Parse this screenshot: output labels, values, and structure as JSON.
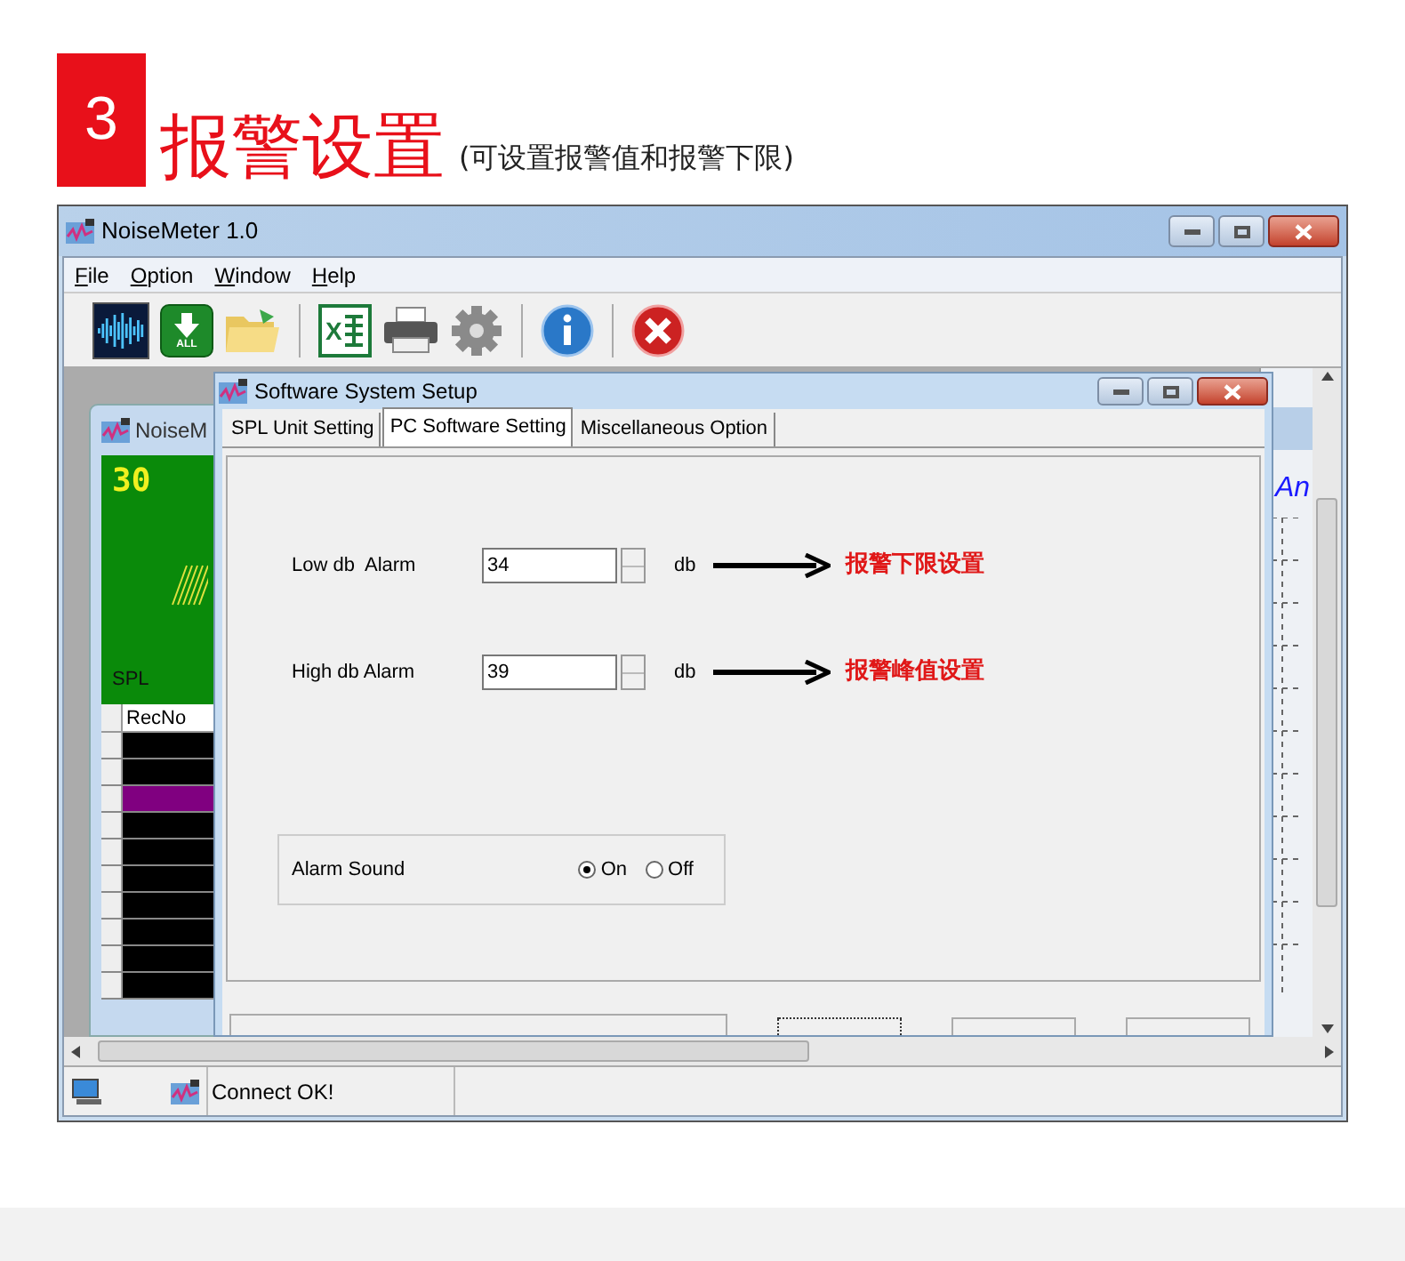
{
  "header": {
    "step": "3",
    "title": "报警设置",
    "subtitle": "(可设置报警值和报警下限)"
  },
  "window": {
    "title": "NoiseMeter 1.0"
  },
  "menu": [
    "File",
    "Option",
    "Window",
    "Help"
  ],
  "toolbar": [
    {
      "kind": "waveform"
    },
    {
      "kind": "download",
      "caption": "ALL"
    },
    {
      "kind": "folder"
    },
    {
      "kind": "separator"
    },
    {
      "kind": "excel",
      "caption": "X"
    },
    {
      "kind": "printer"
    },
    {
      "kind": "gear"
    },
    {
      "kind": "separator"
    },
    {
      "kind": "info"
    },
    {
      "kind": "separator"
    },
    {
      "kind": "close"
    }
  ],
  "child_window": {
    "title": "NoiseM",
    "meter_reading": "30",
    "meter_label": "SPL",
    "table_column": "RecNo",
    "rows": [
      {
        "color": "#000000"
      },
      {
        "color": "#000000"
      },
      {
        "color": "#800080"
      },
      {
        "color": "#000000"
      },
      {
        "color": "#000000"
      },
      {
        "color": "#000000"
      },
      {
        "color": "#000000"
      },
      {
        "color": "#000000"
      },
      {
        "color": "#000000"
      },
      {
        "color": "#000000"
      }
    ]
  },
  "chart_fragment": {
    "text": "An"
  },
  "dialog": {
    "title": "Software System Setup",
    "tabs": [
      {
        "label": "SPL Unit Setting",
        "selected": false
      },
      {
        "label": "PC Software Setting",
        "selected": true
      },
      {
        "label": "Miscellaneous Option",
        "selected": false
      }
    ],
    "fields": [
      {
        "label": "Low db  Alarm",
        "value": "34",
        "unit": "db",
        "annotation": "报警下限设置"
      },
      {
        "label": "High db Alarm",
        "value": "39",
        "unit": "db",
        "annotation": "报警峰值设置"
      }
    ],
    "alarm_sound": {
      "label": "Alarm Sound",
      "options": [
        {
          "label": "On",
          "selected": true
        },
        {
          "label": "Off",
          "selected": false
        }
      ]
    }
  },
  "status_bar": {
    "text": "Connect OK!"
  }
}
